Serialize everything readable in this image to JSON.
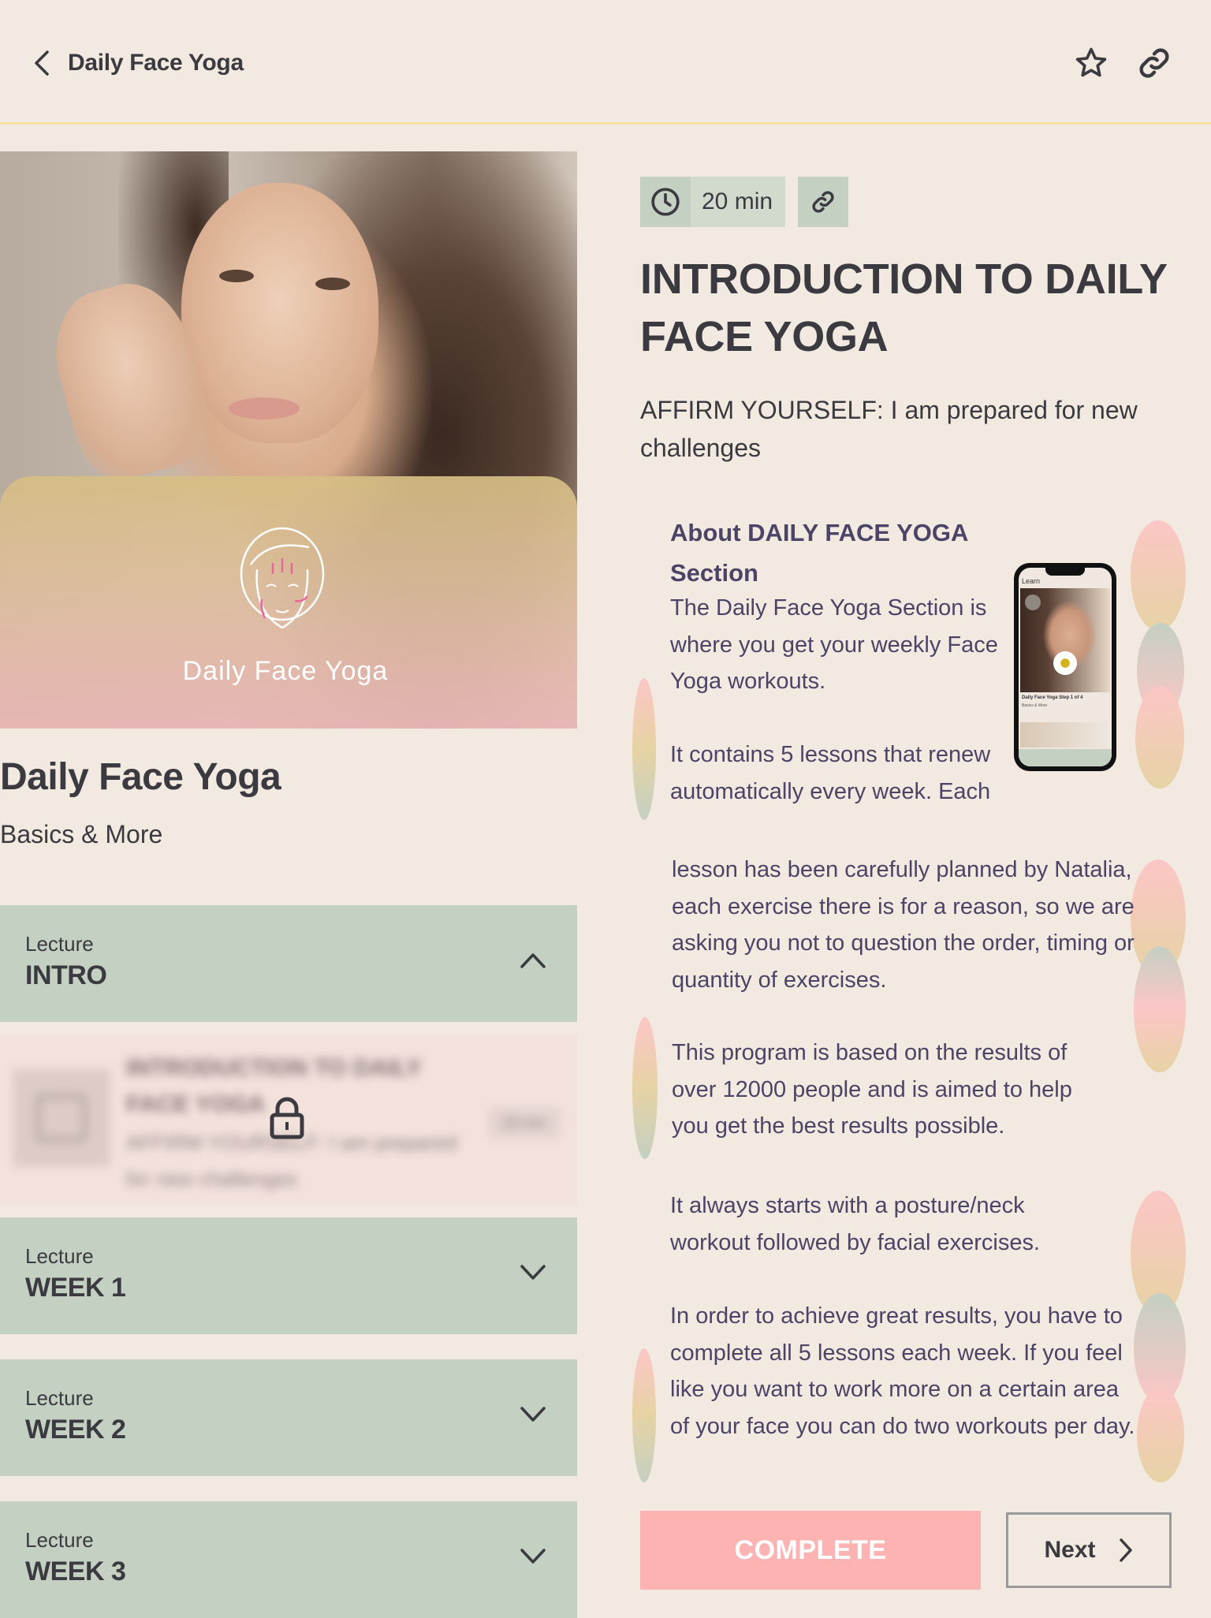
{
  "header": {
    "back_icon": "chevron-left-icon",
    "title": "Daily Face Yoga",
    "actions": [
      {
        "name": "favorite",
        "icon": "star-icon"
      },
      {
        "name": "share-link",
        "icon": "link-icon"
      }
    ]
  },
  "course": {
    "hero_logo_text": "Daily Face Yoga",
    "title": "Daily Face Yoga",
    "subtitle": "Basics & More"
  },
  "lectures": [
    {
      "label": "Lecture",
      "name": "INTRO",
      "expanded": true,
      "chevron": "chevron-up-icon"
    },
    {
      "label": "Lecture",
      "name": "WEEK 1",
      "expanded": false,
      "chevron": "chevron-down-icon"
    },
    {
      "label": "Lecture",
      "name": "WEEK 2",
      "expanded": false,
      "chevron": "chevron-down-icon"
    },
    {
      "label": "Lecture",
      "name": "WEEK 3",
      "expanded": false,
      "chevron": "chevron-down-icon"
    }
  ],
  "locked_lesson": {
    "title": "INTRODUCTION TO DAILY FACE YOGA",
    "description": "AFFIRM YOURSELF: I am prepared for new challenges",
    "duration": "20 min",
    "locked": true,
    "icon": "lock-icon"
  },
  "lesson": {
    "duration": "20 min",
    "title": "INTRODUCTION TO DAILY FACE YOGA",
    "affirmation": "AFFIRM YOURSELF: I am prepared for new challenges",
    "about_heading": "About DAILY FACE YOGA Section",
    "paragraphs": [
      "The Daily Face Yoga Section is where you get your weekly Face Yoga workouts.",
      "It contains 5 lessons that renew automatically every week. Each",
      "lesson has been carefully planned by Natalia, each exercise there is for a reason, so we are asking you not to question the order, timing or quantity of exercises.",
      "This program is based on the results of over 12000 people and is aimed to help you get the best results possible.",
      "It always starts with a posture/neck workout followed by facial exercises.",
      "In order to achieve great results, you have to complete all 5 lessons each week. If you feel like you want to work more on a certain area of your face you can do two workouts per day."
    ],
    "phone_mockup": {
      "screen_title": "Learn",
      "card_title": "Daily Face Yoga Step 1 of 4",
      "card_subtitle": "Basics & More"
    }
  },
  "footer": {
    "complete_label": "COMPLETE",
    "next_label": "Next"
  },
  "colors": {
    "background": "#f2e9e1",
    "header_border": "#f8dfa6",
    "lecture_bg": "#c4d0c2",
    "complete_bg": "#feb3b3",
    "text_dark": "#3a3a40",
    "body_text": "#4c4466"
  }
}
